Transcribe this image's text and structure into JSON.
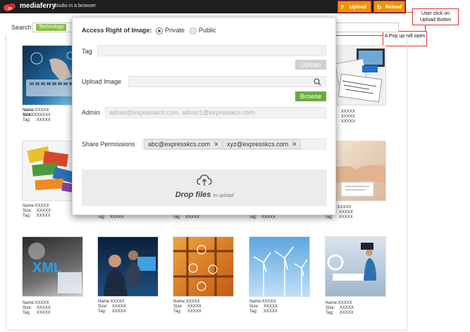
{
  "app": {
    "brand": "mediaferry",
    "tagline": "Studio in a browser"
  },
  "toolbar": {
    "upload_label": "Upload",
    "reload_label": "Reload"
  },
  "annotations": {
    "click_note": "User click on Upload Button",
    "popup_note": "A Pop up will open"
  },
  "search": {
    "label": "Search",
    "tag": "Technology"
  },
  "modal": {
    "access_label": "Access Right of Image:",
    "private_label": "Private",
    "public_label": "Public",
    "selected": "Private",
    "tag_label": "Tag",
    "tag_upload_label": "Upload",
    "upload_image_label": "Upload Image",
    "browse_label": "Browse",
    "admin_label": "Admin",
    "admin_placeholder": "admin@expresskcs.com, admin1@expresskcs.com",
    "share_label": "Share Permissions",
    "share_emails": [
      "abc@expresskcs.com",
      "xyz@expresskcs.com"
    ],
    "drop_title": "Drop files",
    "drop_sub": "to upload"
  },
  "meta_labels": {
    "name": "Name:",
    "size": "Size:",
    "tag": "Tag:"
  },
  "items": [
    {
      "name": "XXXXX",
      "size": "XXXXX",
      "tag": "XXXXX"
    },
    {
      "name": "XXXXX",
      "size": "XXXXX",
      "tag": "XXXXX"
    },
    {
      "name": "XXXXX",
      "size": "XXXXX",
      "tag": "XXXXX"
    },
    {
      "name": "XXXXX",
      "size": "XXXXX",
      "tag": "XXXXX"
    },
    {
      "name": "XXXXX",
      "size": "XXXXX",
      "tag": "XXXXX"
    },
    {
      "name": "XXXXX",
      "size": "XXXXX",
      "tag": "XXXXX"
    },
    {
      "name": "XXXXX",
      "size": "XXXXX",
      "tag": "XXXXX"
    },
    {
      "name": "XXXXX",
      "size": "XXXXX",
      "tag": "XXXXX"
    },
    {
      "name": "XXXXX",
      "size": "XXXXX",
      "tag": "XXXXX"
    },
    {
      "name": "XXXXX",
      "size": "XXXXX",
      "tag": "XXXXX"
    },
    {
      "name": "XXXXX",
      "size": "XXXXX",
      "tag": "XXXXX"
    },
    {
      "name": "XXXXX",
      "size": "XXXXX",
      "tag": "XXXXX"
    },
    {
      "name": "XXXXX",
      "size": "XXXXX",
      "tag": "XXXXX"
    }
  ],
  "thumb_texts": {
    "xml": "XML"
  },
  "colors": {
    "accent_orange": "#f29100",
    "accent_green": "#6aab3e",
    "tag_green": "#8bbd4c",
    "annotation_red": "#dd3333"
  }
}
